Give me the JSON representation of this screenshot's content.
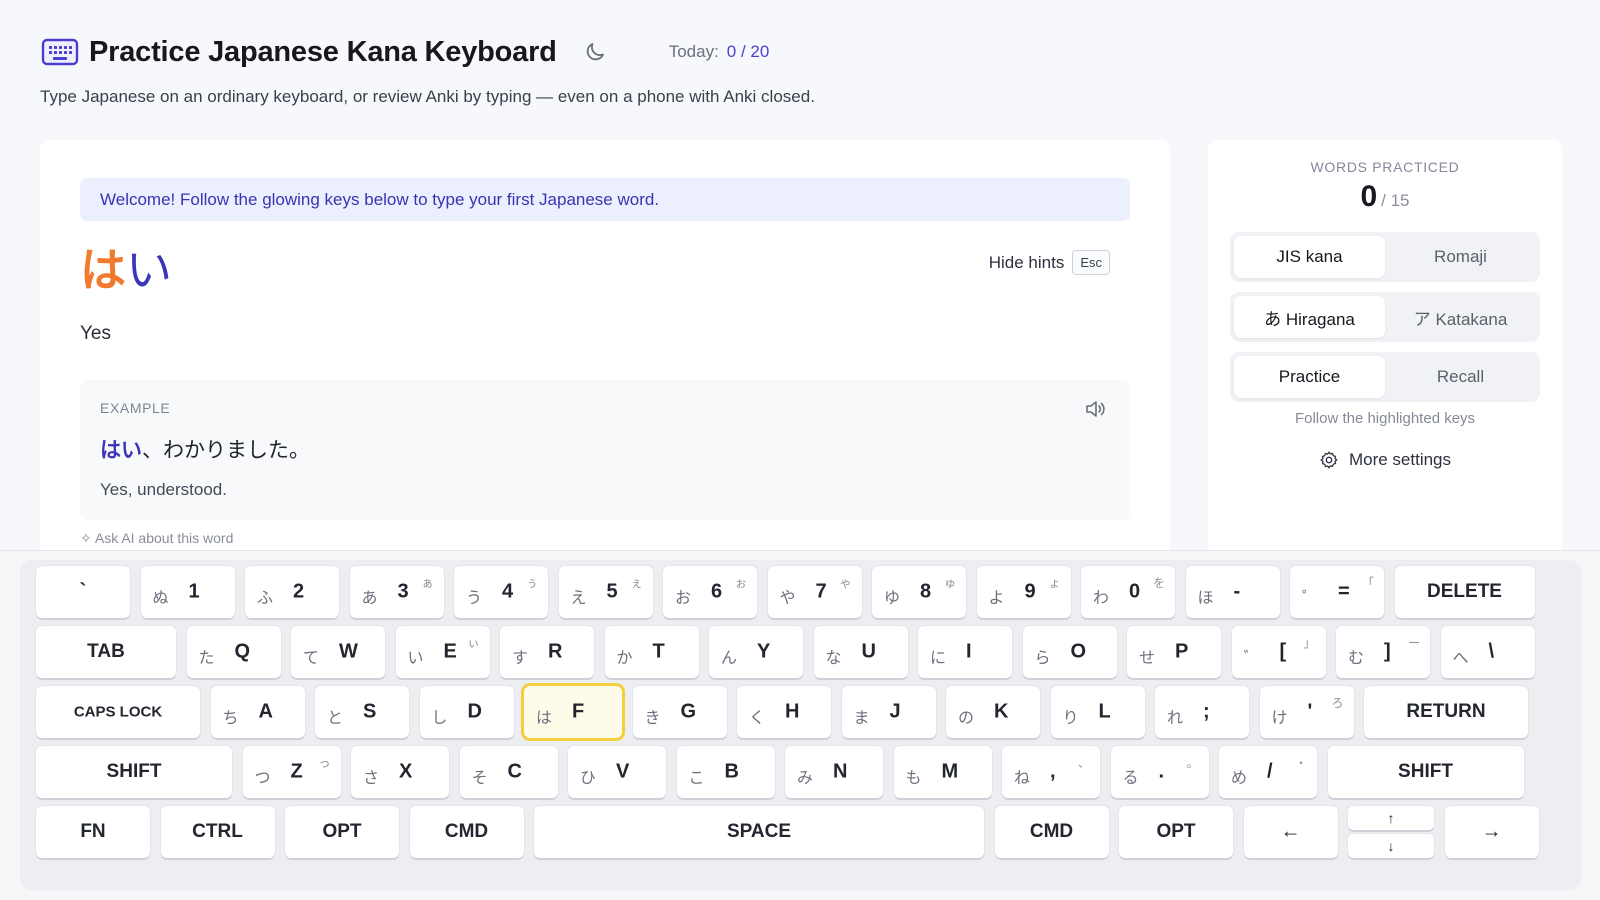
{
  "app": {
    "title": "Practice Japanese Kana Keyboard",
    "today_label": "Today:",
    "today_value": "0 / 20",
    "subtitle": "Type Japanese on an ordinary keyboard, or review Anki by typing — even on a phone with Anki closed."
  },
  "lesson": {
    "welcome": "Welcome! Follow the glowing keys below to type your first Japanese word.",
    "word_part1": "は",
    "word_part2": "い",
    "hide_hints": "Hide hints",
    "esc": "Esc",
    "meaning": "Yes",
    "example_label": "EXAMPLE",
    "example_highlight": "はい",
    "example_rest": "、わかりました。",
    "example_translation": "Yes, understood.",
    "ask_ai": "Ask AI about this word"
  },
  "side": {
    "words_label": "WORDS PRACTICED",
    "words_count": "0",
    "words_total": "/ 15",
    "layout_options": [
      "JIS kana",
      "Romaji"
    ],
    "script_options": [
      "あ Hiragana",
      "ア Katakana"
    ],
    "mode_options": [
      "Practice",
      "Recall"
    ],
    "selected": {
      "layout": "JIS kana",
      "script": "あ Hiragana",
      "mode": "Practice"
    },
    "hint_note": "Follow the highlighted keys",
    "more_settings": "More settings"
  },
  "keyboard": {
    "highlighted_key": "F",
    "rows": [
      [
        {
          "main": "`",
          "kana": "",
          "sm": ""
        },
        {
          "main": "1",
          "kana": "ぬ",
          "sm": ""
        },
        {
          "main": "2",
          "kana": "ふ",
          "sm": ""
        },
        {
          "main": "3",
          "kana": "あ",
          "sm": "ぁ"
        },
        {
          "main": "4",
          "kana": "う",
          "sm": "ぅ"
        },
        {
          "main": "5",
          "kana": "え",
          "sm": "ぇ"
        },
        {
          "main": "6",
          "kana": "お",
          "sm": "ぉ"
        },
        {
          "main": "7",
          "kana": "や",
          "sm": "ゃ"
        },
        {
          "main": "8",
          "kana": "ゆ",
          "sm": "ゅ"
        },
        {
          "main": "9",
          "kana": "よ",
          "sm": "ょ"
        },
        {
          "main": "0",
          "kana": "わ",
          "sm": "を"
        },
        {
          "main": "-",
          "kana": "ほ",
          "sm": ""
        },
        {
          "main": "=",
          "kana": "゜",
          "sm": "「"
        },
        {
          "main": "DELETE",
          "kana": "",
          "sm": ""
        }
      ],
      [
        {
          "main": "TAB",
          "kana": "",
          "sm": ""
        },
        {
          "main": "Q",
          "kana": "た",
          "sm": ""
        },
        {
          "main": "W",
          "kana": "て",
          "sm": ""
        },
        {
          "main": "E",
          "kana": "い",
          "sm": "ぃ"
        },
        {
          "main": "R",
          "kana": "す",
          "sm": ""
        },
        {
          "main": "T",
          "kana": "か",
          "sm": ""
        },
        {
          "main": "Y",
          "kana": "ん",
          "sm": ""
        },
        {
          "main": "U",
          "kana": "な",
          "sm": ""
        },
        {
          "main": "I",
          "kana": "に",
          "sm": ""
        },
        {
          "main": "O",
          "kana": "ら",
          "sm": ""
        },
        {
          "main": "P",
          "kana": "せ",
          "sm": ""
        },
        {
          "main": "[",
          "kana": "゛",
          "sm": "」"
        },
        {
          "main": "]",
          "kana": "む",
          "sm": "ー"
        },
        {
          "main": "\\",
          "kana": "へ",
          "sm": ""
        }
      ],
      [
        {
          "main": "CAPS LOCK",
          "kana": "",
          "sm": ""
        },
        {
          "main": "A",
          "kana": "ち",
          "sm": ""
        },
        {
          "main": "S",
          "kana": "と",
          "sm": ""
        },
        {
          "main": "D",
          "kana": "し",
          "sm": ""
        },
        {
          "main": "F",
          "kana": "は",
          "sm": ""
        },
        {
          "main": "G",
          "kana": "き",
          "sm": ""
        },
        {
          "main": "H",
          "kana": "く",
          "sm": ""
        },
        {
          "main": "J",
          "kana": "ま",
          "sm": ""
        },
        {
          "main": "K",
          "kana": "の",
          "sm": ""
        },
        {
          "main": "L",
          "kana": "り",
          "sm": ""
        },
        {
          "main": ";",
          "kana": "れ",
          "sm": ""
        },
        {
          "main": "'",
          "kana": "け",
          "sm": "ろ"
        },
        {
          "main": "RETURN",
          "kana": "",
          "sm": ""
        }
      ],
      [
        {
          "main": "SHIFT",
          "kana": "",
          "sm": ""
        },
        {
          "main": "Z",
          "kana": "つ",
          "sm": "っ"
        },
        {
          "main": "X",
          "kana": "さ",
          "sm": ""
        },
        {
          "main": "C",
          "kana": "そ",
          "sm": ""
        },
        {
          "main": "V",
          "kana": "ひ",
          "sm": ""
        },
        {
          "main": "B",
          "kana": "こ",
          "sm": ""
        },
        {
          "main": "N",
          "kana": "み",
          "sm": ""
        },
        {
          "main": "M",
          "kana": "も",
          "sm": ""
        },
        {
          "main": ",",
          "kana": "ね",
          "sm": "、"
        },
        {
          "main": ".",
          "kana": "る",
          "sm": "。"
        },
        {
          "main": "/",
          "kana": "め",
          "sm": "・"
        },
        {
          "main": "SHIFT",
          "kana": "",
          "sm": ""
        }
      ],
      [
        {
          "main": "FN",
          "kana": "",
          "sm": ""
        },
        {
          "main": "CTRL",
          "kana": "",
          "sm": ""
        },
        {
          "main": "OPT",
          "kana": "",
          "sm": ""
        },
        {
          "main": "CMD",
          "kana": "",
          "sm": ""
        },
        {
          "main": "SPACE",
          "kana": "",
          "sm": ""
        },
        {
          "main": "CMD",
          "kana": "",
          "sm": ""
        },
        {
          "main": "OPT",
          "kana": "",
          "sm": ""
        },
        {
          "main": "←",
          "kana": "",
          "sm": ""
        },
        {
          "main": "↑",
          "kana": "",
          "sm": "",
          "second": "↓"
        },
        {
          "main": "→",
          "kana": "",
          "sm": ""
        }
      ]
    ]
  },
  "colors": {
    "accent": "#4b3fd1",
    "orange": "#f27a2f",
    "glow": "#f4cf3c"
  }
}
